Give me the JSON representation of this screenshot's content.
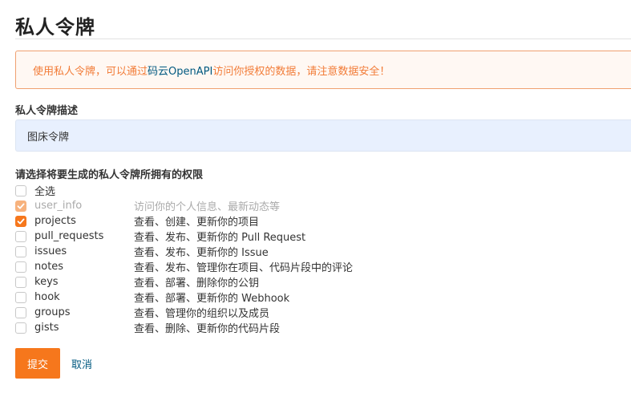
{
  "page": {
    "title": "私人令牌"
  },
  "alert": {
    "text_before": "使用私人令牌，可以通过 ",
    "link": "码云OpenAPI",
    "text_after": " 访问你授权的数据，请注意数据安全！"
  },
  "description": {
    "label": "私人令牌描述",
    "value": "图床令牌"
  },
  "permissions": {
    "label": "请选择将要生成的私人令牌所拥有的权限",
    "select_all": "全选",
    "items": [
      {
        "name": "user_info",
        "desc": "访问你的个人信息、最新动态等",
        "checked": true,
        "disabled": true
      },
      {
        "name": "projects",
        "desc": "查看、创建、更新你的项目",
        "checked": true,
        "disabled": false
      },
      {
        "name": "pull_requests",
        "desc": "查看、发布、更新你的 Pull Request",
        "checked": false,
        "disabled": false
      },
      {
        "name": "issues",
        "desc": "查看、发布、更新你的 Issue",
        "checked": false,
        "disabled": false
      },
      {
        "name": "notes",
        "desc": "查看、发布、管理你在项目、代码片段中的评论",
        "checked": false,
        "disabled": false
      },
      {
        "name": "keys",
        "desc": "查看、部署、删除你的公钥",
        "checked": false,
        "disabled": false
      },
      {
        "name": "hook",
        "desc": "查看、部署、更新你的 Webhook",
        "checked": false,
        "disabled": false
      },
      {
        "name": "groups",
        "desc": "查看、管理你的组织以及成员",
        "checked": false,
        "disabled": false
      },
      {
        "name": "gists",
        "desc": "查看、删除、更新你的代码片段",
        "checked": false,
        "disabled": false
      }
    ]
  },
  "actions": {
    "submit": "提交",
    "cancel": "取消"
  },
  "colors": {
    "accent": "#f6771c",
    "alert_text": "#f27c38",
    "link": "#005980",
    "input_bg": "#e8f0fe"
  }
}
